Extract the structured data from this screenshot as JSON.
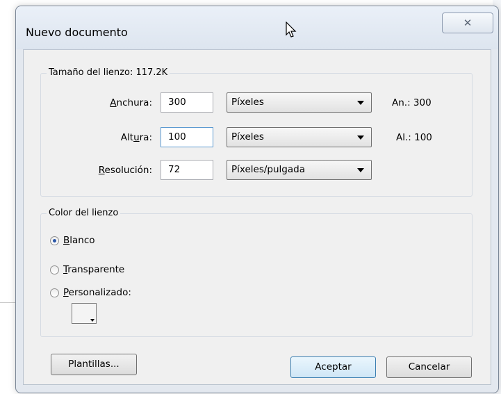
{
  "dialog": {
    "title": "Nuevo documento",
    "close_icon": "close-icon"
  },
  "canvas_size": {
    "legend": "Tamaño del lienzo: 117.2K",
    "width": {
      "label_pre": "",
      "label_mn": "A",
      "label_post": "nchura:",
      "value": "300",
      "unit": "Píxeles",
      "info": "An.: 300"
    },
    "height": {
      "label_pre": "Alt",
      "label_mn": "u",
      "label_post": "ra:",
      "value": "100",
      "unit": "Píxeles",
      "info": "Al.: 100"
    },
    "resolution": {
      "label_pre": "",
      "label_mn": "R",
      "label_post": "esolución:",
      "value": "72",
      "unit": "Píxeles/pulgada"
    }
  },
  "canvas_color": {
    "legend": "Color del lienzo",
    "options": [
      {
        "mn": "B",
        "rest": "lanco",
        "checked": true
      },
      {
        "mn": "T",
        "rest": "ransparente",
        "checked": false
      },
      {
        "mn": "P",
        "rest": "ersonalizado:",
        "checked": false
      }
    ]
  },
  "buttons": {
    "templates": "Plantillas...",
    "ok": "Aceptar",
    "cancel": "Cancelar"
  }
}
